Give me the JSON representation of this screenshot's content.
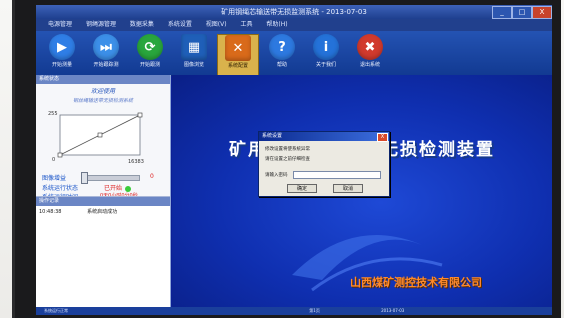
{
  "window": {
    "title": "矿用钢绳芯输送带无损监测系统 - 2013-07-03",
    "controls": [
      "_",
      "□",
      "X"
    ]
  },
  "menu": [
    "电源管理",
    "钢绳源管理",
    "数据采集",
    "系统设置",
    "视图(V)",
    "工具",
    "帮助(H)"
  ],
  "toolbar": [
    {
      "label": "开始测量",
      "icon": "play-icon",
      "color": "#2f7ee6"
    },
    {
      "label": "开始跟踪测",
      "icon": "skip-icon",
      "color": "#3c8fe8"
    },
    {
      "label": "开始跟测",
      "icon": "refresh-icon",
      "color": "#29a63d"
    },
    {
      "label": "图像浏览",
      "icon": "image-browse-icon",
      "color": "#1f5fb8"
    },
    {
      "label": "系统配置",
      "icon": "tools-icon",
      "color": "#d96a1a"
    },
    {
      "label": "帮助",
      "icon": "help-icon",
      "color": "#2d79e0"
    },
    {
      "label": "关于我们",
      "icon": "info-icon",
      "color": "#2472d9"
    },
    {
      "label": "退出系统",
      "icon": "exit-icon",
      "color": "#d13a2d"
    }
  ],
  "left_panel": {
    "title": "系统状态",
    "welcome": "欢迎使用",
    "system_name": "钢丝绳输送带无损检测系统",
    "chart": {
      "y_max_label": "255",
      "y_min_label": "0",
      "x_max_label": "16383"
    },
    "gain_label": "图像增益",
    "gain_value": "0",
    "run_status_label": "系统运行状态",
    "run_status_value": "已开始",
    "run_time_label": "系统运行时间",
    "run_time_value": "0天0小时0分0秒",
    "log_title": "操作记录",
    "log_rows": [
      {
        "time": "10:48:38",
        "event": "系统启动成功"
      }
    ]
  },
  "main": {
    "title": "矿用钢绳芯输送带无损检测装置",
    "company": "山西煤矿测控技术有限公司"
  },
  "dialog": {
    "title": "系统设置",
    "close": "X",
    "line1": "修改设置将使系统异常",
    "line2": "请在设置之前仔细检查",
    "password_label": "请输入密码",
    "password_value": "",
    "ok": "确定",
    "cancel": "取消"
  },
  "statusbar": [
    "系统运行正常",
    "第1页",
    "2013-07-03"
  ]
}
